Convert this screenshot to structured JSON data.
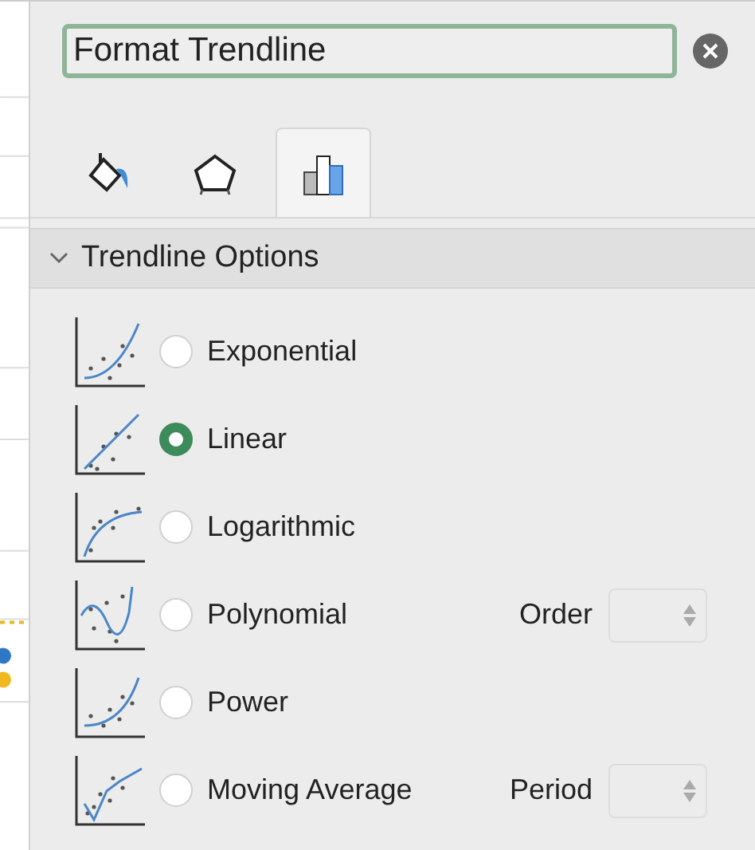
{
  "pane": {
    "title": "Format Trendline"
  },
  "tabs": [
    {
      "kind": "fill",
      "selected": false
    },
    {
      "kind": "effects",
      "selected": false
    },
    {
      "kind": "options",
      "selected": true
    }
  ],
  "section": {
    "title": "Trendline Options",
    "expanded": true
  },
  "options": [
    {
      "kind": "exponential",
      "label": "Exponential",
      "selected": false
    },
    {
      "kind": "linear",
      "label": "Linear",
      "selected": true
    },
    {
      "kind": "logarithmic",
      "label": "Logarithmic",
      "selected": false
    },
    {
      "kind": "polynomial",
      "label": "Polynomial",
      "selected": false,
      "spinner": {
        "label": "Order",
        "disabled": true
      }
    },
    {
      "kind": "power",
      "label": "Power",
      "selected": false
    },
    {
      "kind": "moving-average",
      "label": "Moving Average",
      "selected": false,
      "spinner": {
        "label": "Period",
        "disabled": true
      }
    }
  ]
}
